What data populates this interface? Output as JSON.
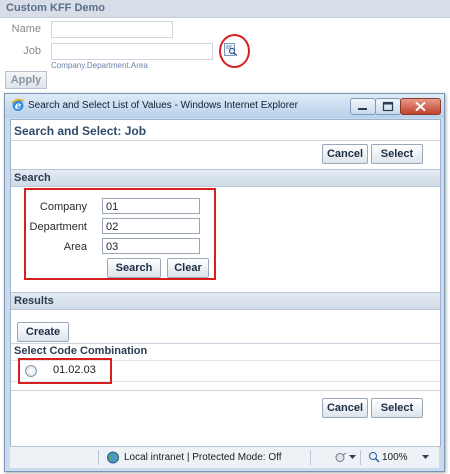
{
  "background": {
    "header_title": "Custom KFF Demo",
    "name_label": "Name",
    "job_label": "Job",
    "job_hint": "Company.Department.Area",
    "apply_label": "Apply"
  },
  "window": {
    "title": "Search and Select List of Values - Windows Internet Explorer",
    "heading": "Search and Select: Job",
    "cancel_label": "Cancel",
    "select_label": "Select"
  },
  "search": {
    "section_title": "Search",
    "fields": [
      {
        "label": "Company",
        "value": "01"
      },
      {
        "label": "Department",
        "value": "02"
      },
      {
        "label": "Area",
        "value": "03"
      }
    ],
    "search_label": "Search",
    "clear_label": "Clear"
  },
  "results": {
    "section_title": "Results",
    "create_label": "Create",
    "column_header": "Select Code Combination",
    "rows": [
      {
        "value": "01.02.03"
      }
    ]
  },
  "statusbar": {
    "zone": "Local intranet | Protected Mode: Off",
    "zoom": "100%"
  },
  "colors": {
    "accent": "#d61f1f",
    "header": "#2f4a6a"
  }
}
